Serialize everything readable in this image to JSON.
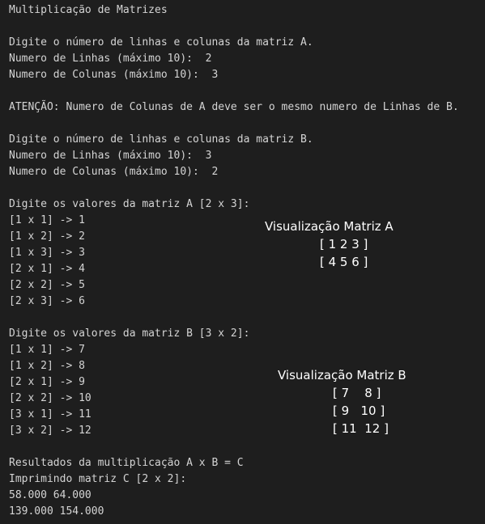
{
  "console_lines": [
    "Multiplicação de Matrizes",
    "",
    "Digite o número de linhas e colunas da matriz A.",
    "Numero de Linhas (máximo 10):  2",
    "Numero de Colunas (máximo 10):  3",
    "",
    "ATENÇÃO: Numero de Colunas de A deve ser o mesmo numero de Linhas de B.",
    "",
    "Digite o número de linhas e colunas da matriz B.",
    "Numero de Linhas (máximo 10):  3",
    "Numero de Colunas (máximo 10):  2",
    "",
    "Digite os valores da matriz A [2 x 3]:",
    "[1 x 1] -> 1",
    "[1 x 2] -> 2",
    "[1 x 3] -> 3",
    "[2 x 1] -> 4",
    "[2 x 2] -> 5",
    "[2 x 3] -> 6",
    "",
    "Digite os valores da matriz B [3 x 2]:",
    "[1 x 1] -> 7",
    "[1 x 2] -> 8",
    "[2 x 1] -> 9",
    "[2 x 2] -> 10",
    "[3 x 1] -> 11",
    "[3 x 2] -> 12",
    "",
    "Resultados da multiplicação A x B = C",
    "Imprimindo matriz C [2 x 2]:",
    "58.000 64.000",
    "139.000 154.000"
  ],
  "matrix_a_view": {
    "title": "Visualização Matriz A",
    "rows": [
      "[ 1 2 3 ]",
      "[ 4 5 6 ]"
    ]
  },
  "matrix_b_view": {
    "title": "Visualização Matriz B",
    "rows": [
      "[ 7    8 ]",
      "[ 9   10 ]",
      "[ 11  12 ]"
    ]
  }
}
